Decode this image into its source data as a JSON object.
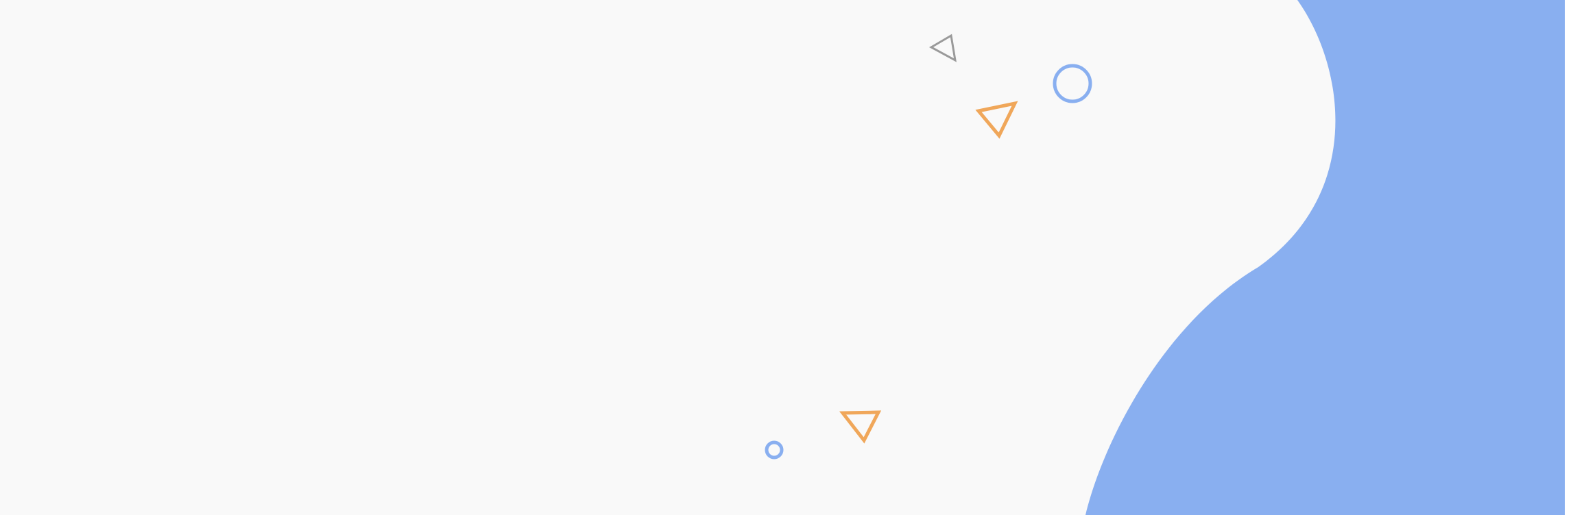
{
  "colors": {
    "page_background": "#f9f9f9",
    "right_strip": "#ffffff",
    "blob": "#89aff0",
    "accent_blue": "#89aff0",
    "accent_orange": "#f0a75a",
    "accent_gray": "#9a9a9a"
  },
  "decorations": [
    {
      "icon": "triangle-outline-icon",
      "color": "gray"
    },
    {
      "icon": "circle-outline-icon",
      "color": "blue"
    },
    {
      "icon": "triangle-outline-icon",
      "color": "orange"
    },
    {
      "icon": "triangle-outline-icon",
      "color": "orange"
    },
    {
      "icon": "circle-outline-icon",
      "color": "blue"
    }
  ]
}
